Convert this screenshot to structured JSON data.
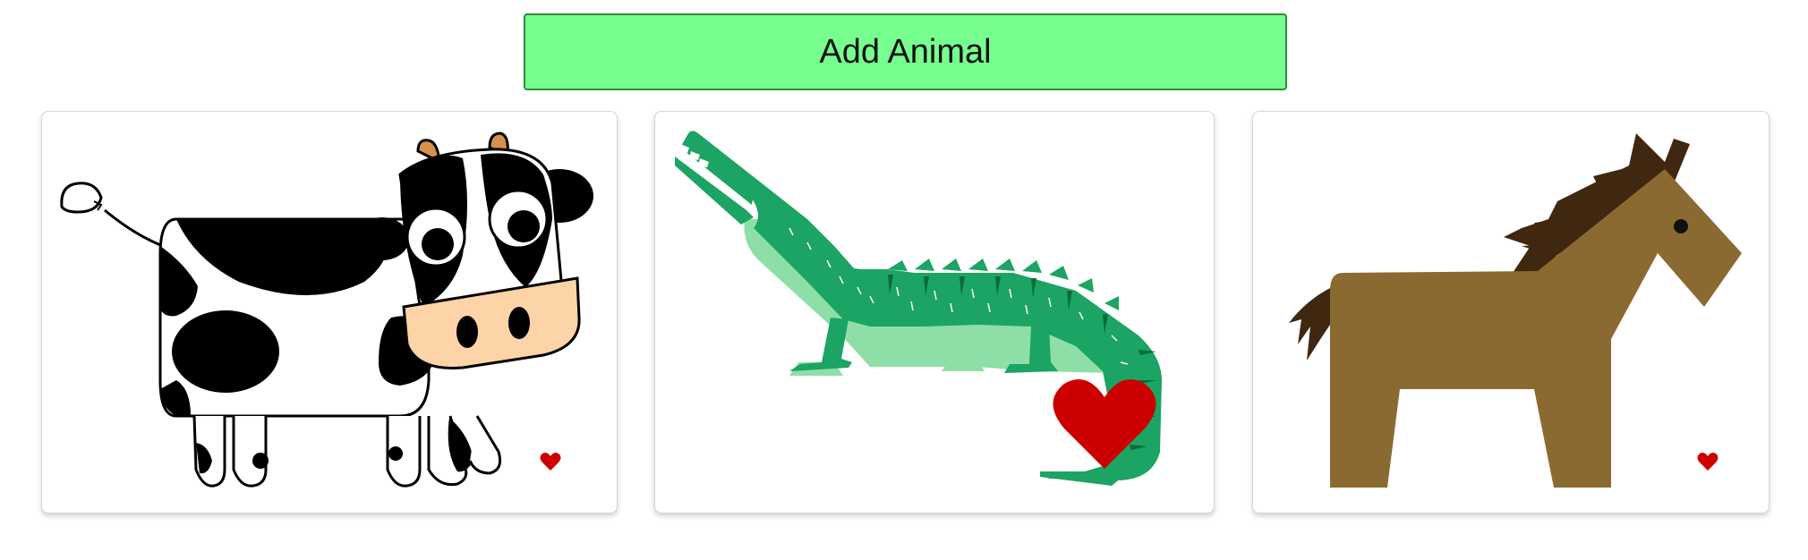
{
  "toolbar": {
    "add_label": "Add Animal"
  },
  "colors": {
    "button_bg": "#76ff8e",
    "heart": "#cc0000",
    "croc_green": "#1ba463",
    "croc_light": "#8ddfa7",
    "horse_body": "#8b6a32",
    "horse_mane": "#3f2710"
  },
  "animals": [
    {
      "icon": "cow-icon",
      "liked": false
    },
    {
      "icon": "crocodile-icon",
      "liked": true
    },
    {
      "icon": "horse-icon",
      "liked": false
    }
  ]
}
